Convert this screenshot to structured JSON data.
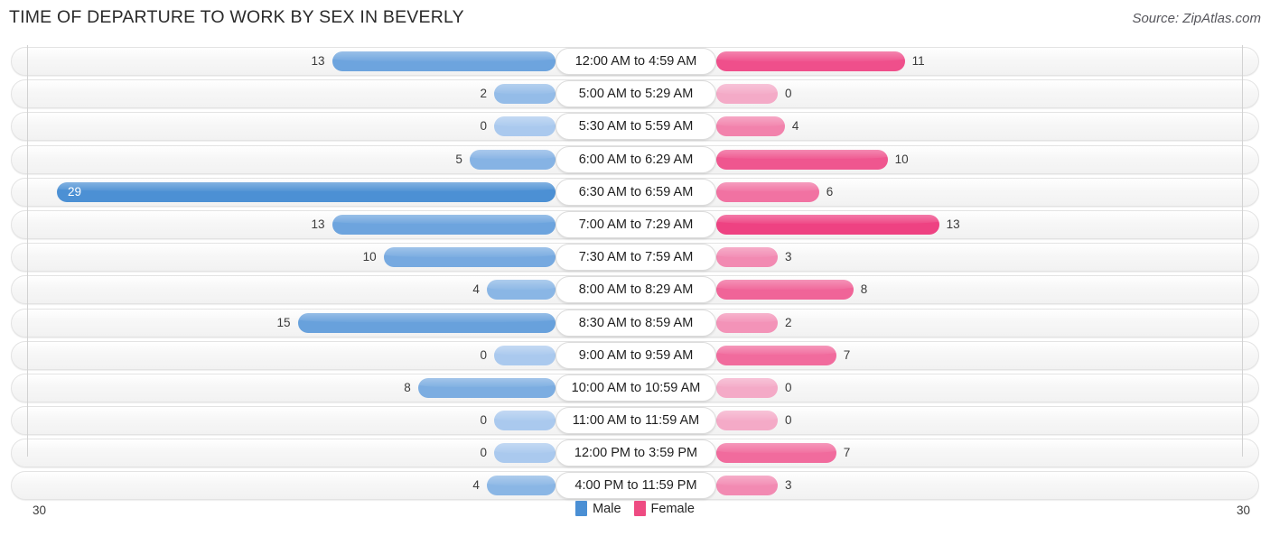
{
  "header": {
    "title": "TIME OF DEPARTURE TO WORK BY SEX IN BEVERLY",
    "source": "Source: ZipAtlas.com"
  },
  "legend": {
    "items": [
      {
        "label": "Male",
        "color": "#4a8fd4"
      },
      {
        "label": "Female",
        "color": "#ee4b82"
      }
    ]
  },
  "axis": {
    "left_tick": "30",
    "right_tick": "30",
    "max": 30
  },
  "chart_data": {
    "type": "bar",
    "orientation": "horizontal-diverging",
    "title": "TIME OF DEPARTURE TO WORK BY SEX IN BEVERLY",
    "xlabel": "",
    "ylabel": "",
    "xlim": [
      30,
      30
    ],
    "grid": false,
    "legend_position": "bottom-center",
    "categories": [
      "12:00 AM to 4:59 AM",
      "5:00 AM to 5:29 AM",
      "5:30 AM to 5:59 AM",
      "6:00 AM to 6:29 AM",
      "6:30 AM to 6:59 AM",
      "7:00 AM to 7:29 AM",
      "7:30 AM to 7:59 AM",
      "8:00 AM to 8:29 AM",
      "8:30 AM to 8:59 AM",
      "9:00 AM to 9:59 AM",
      "10:00 AM to 10:59 AM",
      "11:00 AM to 11:59 AM",
      "12:00 PM to 3:59 PM",
      "4:00 PM to 11:59 PM"
    ],
    "series": [
      {
        "name": "Male",
        "values": [
          13,
          2,
          0,
          5,
          29,
          13,
          10,
          4,
          15,
          0,
          8,
          0,
          0,
          4
        ]
      },
      {
        "name": "Female",
        "values": [
          11,
          0,
          4,
          10,
          6,
          13,
          3,
          8,
          2,
          7,
          0,
          0,
          7,
          3
        ]
      }
    ]
  },
  "rows": [
    {
      "category": "12:00 AM to 4:59 AM",
      "male": "13",
      "female": "11"
    },
    {
      "category": "5:00 AM to 5:29 AM",
      "male": "2",
      "female": "0"
    },
    {
      "category": "5:30 AM to 5:59 AM",
      "male": "0",
      "female": "4"
    },
    {
      "category": "6:00 AM to 6:29 AM",
      "male": "5",
      "female": "10"
    },
    {
      "category": "6:30 AM to 6:59 AM",
      "male": "29",
      "female": "6"
    },
    {
      "category": "7:00 AM to 7:29 AM",
      "male": "13",
      "female": "13"
    },
    {
      "category": "7:30 AM to 7:59 AM",
      "male": "10",
      "female": "3"
    },
    {
      "category": "8:00 AM to 8:29 AM",
      "male": "4",
      "female": "8"
    },
    {
      "category": "8:30 AM to 8:59 AM",
      "male": "15",
      "female": "2"
    },
    {
      "category": "9:00 AM to 9:59 AM",
      "male": "0",
      "female": "7"
    },
    {
      "category": "10:00 AM to 10:59 AM",
      "male": "8",
      "female": "0"
    },
    {
      "category": "11:00 AM to 11:59 AM",
      "male": "0",
      "female": "0"
    },
    {
      "category": "12:00 PM to 3:59 PM",
      "male": "0",
      "female": "7"
    },
    {
      "category": "4:00 PM to 11:59 PM",
      "male": "4",
      "female": "3"
    }
  ]
}
